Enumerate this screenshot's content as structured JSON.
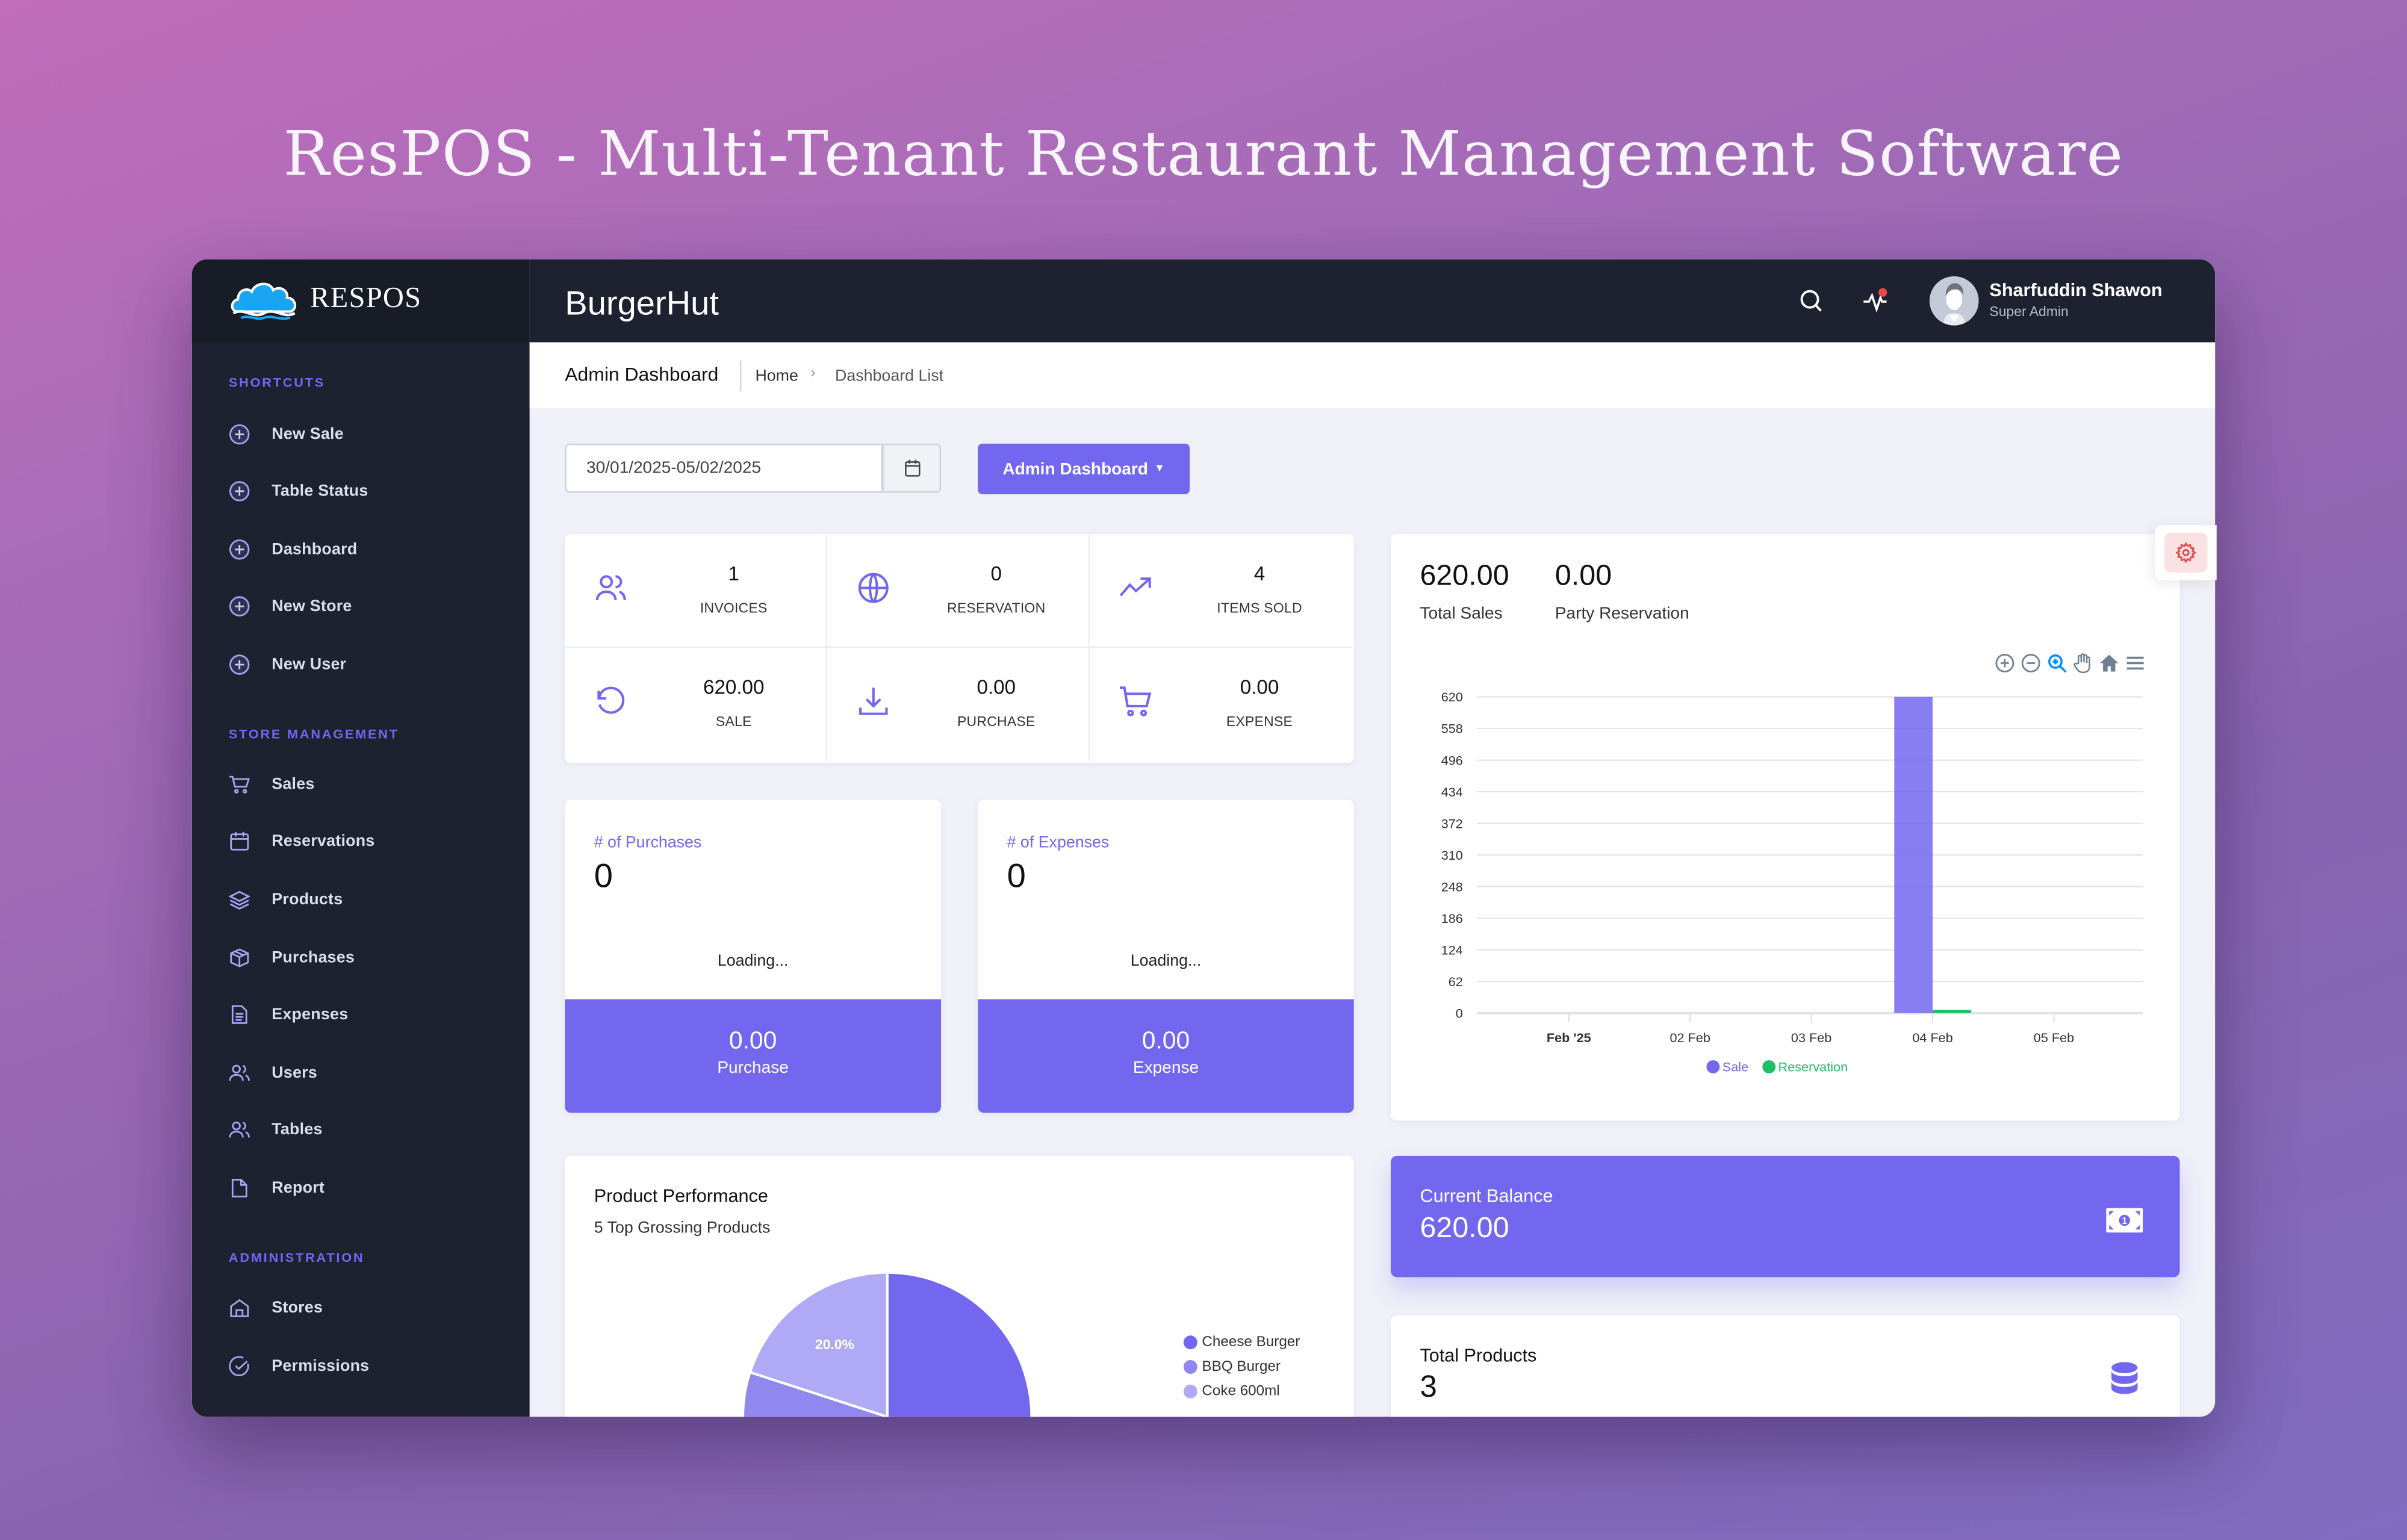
{
  "hero": {
    "title": "ResPOS - Multi-Tenant Restaurant Management Software"
  },
  "brand": {
    "name": "RESPOS",
    "logo_icon": "cloud-logo-icon"
  },
  "topbar": {
    "tenant_name": "BurgerHut",
    "search_icon": "search-icon",
    "activity_icon": "activity-pulse-icon",
    "user": {
      "name": "Sharfuddin Shawon",
      "role": "Super Admin"
    }
  },
  "sidebar": {
    "sections": [
      {
        "title": "SHORTCUTS",
        "items": [
          {
            "label": "New Sale",
            "icon": "plus-circle-icon"
          },
          {
            "label": "Table Status",
            "icon": "plus-circle-icon"
          },
          {
            "label": "Dashboard",
            "icon": "plus-circle-icon"
          },
          {
            "label": "New Store",
            "icon": "plus-circle-icon"
          },
          {
            "label": "New User",
            "icon": "plus-circle-icon"
          }
        ]
      },
      {
        "title": "STORE MANAGEMENT",
        "items": [
          {
            "label": "Sales",
            "icon": "cart-icon"
          },
          {
            "label": "Reservations",
            "icon": "calendar-icon"
          },
          {
            "label": "Products",
            "icon": "layers-icon"
          },
          {
            "label": "Purchases",
            "icon": "box-icon"
          },
          {
            "label": "Expenses",
            "icon": "document-icon"
          },
          {
            "label": "Users",
            "icon": "users-icon"
          },
          {
            "label": "Tables",
            "icon": "users-icon"
          },
          {
            "label": "Report",
            "icon": "file-icon"
          }
        ]
      },
      {
        "title": "ADMINISTRATION",
        "items": [
          {
            "label": "Stores",
            "icon": "store-icon"
          },
          {
            "label": "Permissions",
            "icon": "check-circle-icon"
          }
        ]
      }
    ]
  },
  "breadcrumb": {
    "title": "Admin Dashboard",
    "home": "Home",
    "current": "Dashboard List"
  },
  "filters": {
    "date_range": "30/01/2025-05/02/2025",
    "dashboard_button": "Admin Dashboard"
  },
  "stats": [
    {
      "value": "1",
      "label": "INVOICES",
      "icon": "users-icon"
    },
    {
      "value": "0",
      "label": "RESERVATION",
      "icon": "globe-icon"
    },
    {
      "value": "4",
      "label": "ITEMS SOLD",
      "icon": "trending-up-icon"
    },
    {
      "value": "620.00",
      "label": "SALE",
      "icon": "rotate-ccw-icon"
    },
    {
      "value": "0.00",
      "label": "PURCHASE",
      "icon": "download-icon"
    },
    {
      "value": "0.00",
      "label": "EXPENSE",
      "icon": "cart-icon"
    }
  ],
  "purchases_card": {
    "title": "# of Purchases",
    "count": "0",
    "status": "Loading...",
    "amount": "0.00",
    "amount_label": "Purchase"
  },
  "expenses_card": {
    "title": "# of Expenses",
    "count": "0",
    "status": "Loading...",
    "amount": "0.00",
    "amount_label": "Expense"
  },
  "sales_summary": {
    "total_sales": "620.00",
    "total_sales_label": "Total Sales",
    "party_reservation": "0.00",
    "party_reservation_label": "Party Reservation",
    "toolbar": [
      "zoom-in-icon",
      "zoom-out-icon",
      "selection-zoom-icon",
      "pan-hand-icon",
      "reset-home-icon",
      "menu-icon"
    ]
  },
  "balance": {
    "label": "Current Balance",
    "value": "620.00"
  },
  "total_products": {
    "label": "Total Products",
    "value": "3"
  },
  "product_performance": {
    "title": "Product Performance",
    "subtitle": "5 Top Grossing Products"
  },
  "colors": {
    "accent": "#7367f0",
    "sidebar": "#1e2230",
    "reservation": "#1fbf63",
    "danger": "#e14c4c"
  },
  "chart_data": [
    {
      "type": "bar",
      "title": "",
      "categories": [
        "Feb '25",
        "02 Feb",
        "03 Feb",
        "04 Feb",
        "05 Feb"
      ],
      "series": [
        {
          "name": "Sale",
          "color": "#7367f0",
          "values": [
            0,
            0,
            0,
            620,
            0
          ]
        },
        {
          "name": "Reservation",
          "color": "#1fbf63",
          "values": [
            0,
            0,
            0,
            0,
            0
          ]
        }
      ],
      "yticks": [
        0,
        62,
        124,
        186,
        248,
        310,
        372,
        434,
        496,
        558,
        620
      ],
      "ylim": [
        0,
        620
      ],
      "xlabel": "",
      "ylabel": "",
      "grid": true,
      "legend": "bottom"
    },
    {
      "type": "pie",
      "title": "Product Performance",
      "labels": [
        "Cheese Burger",
        "BBQ Burger",
        "Coke 600ml"
      ],
      "values": [
        55,
        25,
        20
      ],
      "colors": [
        "#7367f0",
        "#9088ef",
        "#b0a9f5"
      ],
      "data_labels": [
        "",
        "",
        "20.0%"
      ],
      "legend": "right"
    }
  ]
}
